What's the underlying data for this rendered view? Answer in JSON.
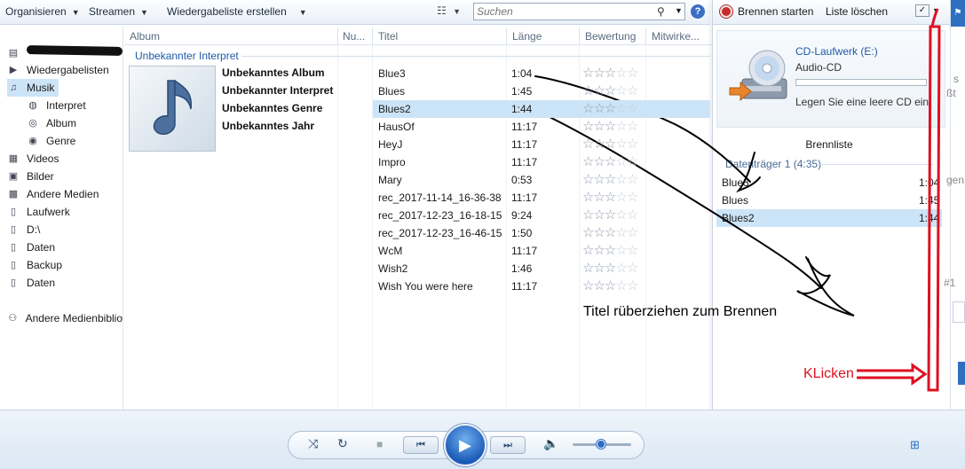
{
  "toolbar": {
    "organize": "Organisieren",
    "stream": "Streamen",
    "create_playlist": "Wiedergabeliste erstellen",
    "view_options": "☷",
    "search_placeholder": "Suchen"
  },
  "nav": {
    "items": [
      {
        "label": "Wiedergabelisten",
        "icon": "playlist-icon"
      },
      {
        "label": "Musik",
        "icon": "music-icon",
        "selected": true
      },
      {
        "label": "Interpret",
        "icon": "artist-icon",
        "sub": true
      },
      {
        "label": "Album",
        "icon": "album-icon",
        "sub": true
      },
      {
        "label": "Genre",
        "icon": "genre-icon",
        "sub": true
      },
      {
        "label": "Videos",
        "icon": "video-icon"
      },
      {
        "label": "Bilder",
        "icon": "picture-icon"
      },
      {
        "label": "Andere Medien",
        "icon": "media-icon"
      },
      {
        "label": "Laufwerk",
        "icon": "drive-icon"
      },
      {
        "label": "D:\\",
        "icon": "drive-icon"
      },
      {
        "label": "Daten",
        "icon": "drive-icon"
      },
      {
        "label": "Backup",
        "icon": "drive-icon"
      },
      {
        "label": "Daten",
        "icon": "drive-icon"
      }
    ],
    "other_libraries": "Andere Medienbiblio"
  },
  "columns": {
    "album": "Album",
    "number": "Nu...",
    "title": "Titel",
    "length": "Länge",
    "rating": "Bewertung",
    "contributing": "Mitwirke..."
  },
  "group": {
    "header": "Unbekannter Interpret",
    "album": "Unbekanntes Album",
    "artist": "Unbekannter Interpret",
    "genre": "Unbekanntes Genre",
    "year": "Unbekanntes Jahr"
  },
  "tracks": [
    {
      "title": "Blue3",
      "length": "1:04"
    },
    {
      "title": "Blues",
      "length": "1:45"
    },
    {
      "title": "Blues2",
      "length": "1:44",
      "selected": true
    },
    {
      "title": "HausOf",
      "length": "11:17"
    },
    {
      "title": "HeyJ",
      "length": "11:17"
    },
    {
      "title": "Impro",
      "length": "11:17"
    },
    {
      "title": "Mary",
      "length": "0:53"
    },
    {
      "title": "rec_2017-11-14_16-36-38",
      "length": "11:17"
    },
    {
      "title": "rec_2017-12-23_16-18-15",
      "length": "9:24"
    },
    {
      "title": "rec_2017-12-23_16-46-15",
      "length": "1:50"
    },
    {
      "title": "WcM",
      "length": "11:17"
    },
    {
      "title": "Wish2",
      "length": "1:46"
    },
    {
      "title": "Wish You were here",
      "length": "11:17"
    }
  ],
  "rating_stars": 3,
  "burn": {
    "start": "Brennen starten",
    "clear": "Liste löschen",
    "drive_name": "CD-Laufwerk (E:)",
    "disc_type": "Audio-CD",
    "hint": "Legen Sie eine leere CD ein.",
    "list_title": "Brennliste",
    "disc_label": "Datenträger 1 (4:35)",
    "items": [
      {
        "title": "Blue3",
        "length": "1:04"
      },
      {
        "title": "Blues",
        "length": "1:45"
      },
      {
        "title": "Blues2",
        "length": "1:44",
        "selected": true
      }
    ]
  },
  "edge": {
    "t1": "s",
    "t2": "ßt",
    "t3": "gen",
    "t4": "#1"
  },
  "annotations": {
    "instruction": "Titel rüberziehen zum Brennen",
    "click": "KLicken"
  },
  "colors": {
    "accent": "#1e5aa8",
    "selection": "#cce4f7",
    "annotation_red": "#dd1122"
  }
}
